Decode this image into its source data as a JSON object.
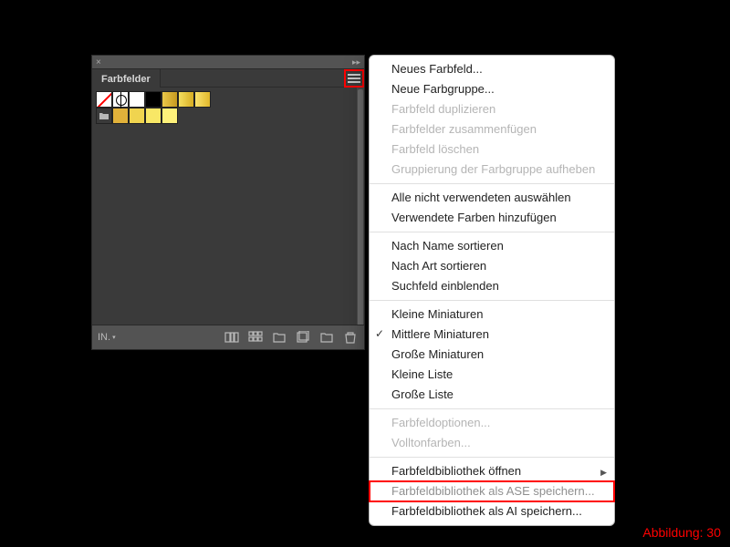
{
  "panel": {
    "tab_label": "Farbfelder",
    "footer_label": "IN.",
    "swatches_row1": [
      "none",
      "registration",
      "white",
      "black",
      "grad1",
      "grad2",
      "grad3"
    ],
    "swatches_row2": [
      "folder",
      "y1",
      "y2",
      "y3",
      "y4"
    ]
  },
  "menu": {
    "groups": [
      [
        {
          "key": "new_swatch",
          "label": "Neues Farbfeld...",
          "enabled": true
        },
        {
          "key": "new_group",
          "label": "Neue Farbgruppe...",
          "enabled": true
        },
        {
          "key": "dup_swatch",
          "label": "Farbfeld duplizieren",
          "enabled": false
        },
        {
          "key": "merge",
          "label": "Farbfelder zusammenfügen",
          "enabled": false
        },
        {
          "key": "delete",
          "label": "Farbfeld löschen",
          "enabled": false
        },
        {
          "key": "ungroup",
          "label": "Gruppierung der Farbgruppe aufheben",
          "enabled": false
        }
      ],
      [
        {
          "key": "select_unused",
          "label": "Alle nicht verwendeten auswählen",
          "enabled": true
        },
        {
          "key": "add_used",
          "label": "Verwendete Farben hinzufügen",
          "enabled": true
        }
      ],
      [
        {
          "key": "sort_name",
          "label": "Nach Name sortieren",
          "enabled": true
        },
        {
          "key": "sort_kind",
          "label": "Nach Art sortieren",
          "enabled": true
        },
        {
          "key": "show_search",
          "label": "Suchfeld einblenden",
          "enabled": true
        }
      ],
      [
        {
          "key": "small_thumb",
          "label": "Kleine Miniaturen",
          "enabled": true
        },
        {
          "key": "med_thumb",
          "label": "Mittlere Miniaturen",
          "enabled": true,
          "checked": true
        },
        {
          "key": "large_thumb",
          "label": "Große Miniaturen",
          "enabled": true
        },
        {
          "key": "small_list",
          "label": "Kleine Liste",
          "enabled": true
        },
        {
          "key": "large_list",
          "label": "Große Liste",
          "enabled": true
        }
      ],
      [
        {
          "key": "swatch_opts",
          "label": "Farbfeldoptionen...",
          "enabled": false
        },
        {
          "key": "spot",
          "label": "Volltonfarben...",
          "enabled": false
        }
      ],
      [
        {
          "key": "open_lib",
          "label": "Farbfeldbibliothek öffnen",
          "enabled": true,
          "submenu": true
        },
        {
          "key": "save_ase",
          "label": "Farbfeldbibliothek als ASE speichern...",
          "enabled": true,
          "highlight": true
        },
        {
          "key": "save_ai",
          "label": "Farbfeldbibliothek als AI speichern...",
          "enabled": true
        }
      ]
    ]
  },
  "caption": "Abbildung: 30"
}
